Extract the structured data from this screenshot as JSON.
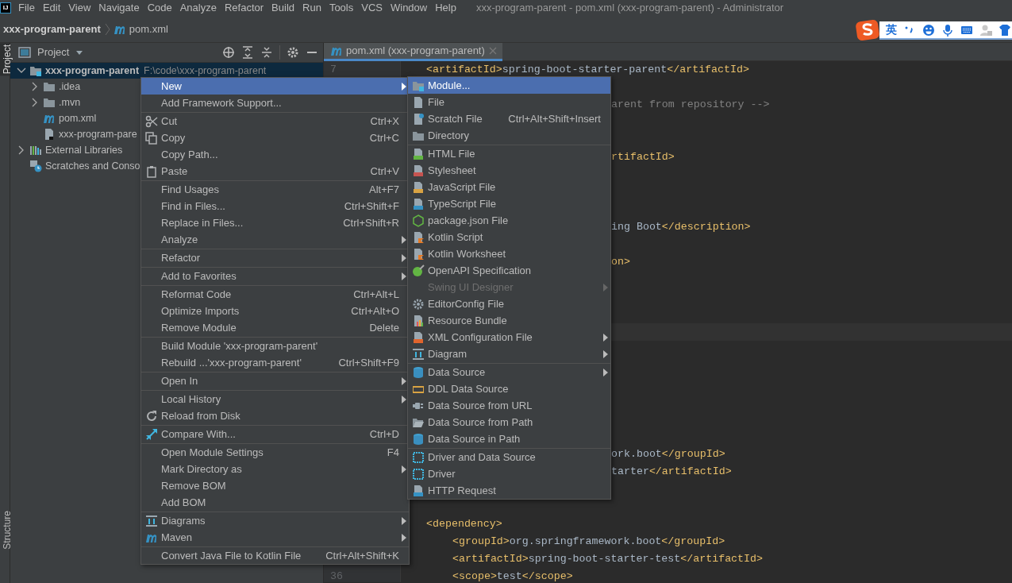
{
  "app_logo": "IJ",
  "menu_bar": [
    "File",
    "Edit",
    "View",
    "Navigate",
    "Code",
    "Analyze",
    "Refactor",
    "Build",
    "Run",
    "Tools",
    "VCS",
    "Window",
    "Help"
  ],
  "window": {
    "title": "xxx-program-parent - pom.xml (xxx-program-parent) - Administrator"
  },
  "breadcrumb": [
    "xxx-program-parent",
    "pom.xml"
  ],
  "ime_toolbar": {
    "language": "英"
  },
  "tool_stripe": [
    {
      "label": "Project",
      "selected": true
    },
    {
      "label": "Structure",
      "selected": false
    }
  ],
  "project_panel": {
    "title": "Project",
    "tree": [
      {
        "label": "xxx-program-parent",
        "path": "F:\\code\\xxx-program-parent",
        "expanded": true,
        "selected": true,
        "children": [
          {
            "label": ".idea",
            "expanded": false,
            "selected": false
          },
          {
            "label": ".mvn",
            "expanded": false,
            "selected": false
          },
          {
            "label": "pom.xml",
            "selected": false
          },
          {
            "label": "xxx-program-pare",
            "selected": false
          }
        ]
      },
      {
        "label": "External Libraries",
        "expanded": false,
        "selected": false
      },
      {
        "label": "Scratches and Conso",
        "selected": false
      }
    ]
  },
  "editor": {
    "tab": "pom.xml (xxx-program-parent)",
    "lines": [
      {
        "number": "7",
        "kind": "outer",
        "segments": [
          {
            "kind": "tag",
            "text": "<artifactId>"
          },
          {
            "kind": "text",
            "text": "spring-boot-starter-parent"
          },
          {
            "kind": "tag",
            "text": "</artifactId>"
          }
        ]
      },
      {
        "kind": "blank"
      },
      {
        "kind": "clipped",
        "segments": [
          {
            "kind": "comment",
            "text": "arent from repository -->"
          }
        ]
      },
      {
        "kind": "blank"
      },
      {
        "kind": "blank"
      },
      {
        "kind": "clipped",
        "segments": [
          {
            "kind": "tag",
            "text": "rtifactId>"
          }
        ]
      },
      {
        "kind": "blank"
      },
      {
        "kind": "blank"
      },
      {
        "kind": "blank"
      },
      {
        "kind": "clipped",
        "segments": [
          {
            "kind": "text",
            "text": "ing Boot"
          },
          {
            "kind": "tag",
            "text": "</description>"
          }
        ]
      },
      {
        "kind": "blank"
      },
      {
        "kind": "clipped",
        "segments": [
          {
            "kind": "tag",
            "text": "on>"
          }
        ]
      },
      {
        "kind": "blank"
      },
      {
        "kind": "blank"
      },
      {
        "kind": "blank"
      },
      {
        "kind": "caret"
      },
      {
        "kind": "blank"
      },
      {
        "kind": "blank"
      },
      {
        "kind": "blank"
      },
      {
        "kind": "blank"
      },
      {
        "kind": "blank"
      },
      {
        "kind": "blank"
      },
      {
        "kind": "clipped",
        "segments": [
          {
            "kind": "text",
            "text": "ork.boot"
          },
          {
            "kind": "tag",
            "text": "</groupId>"
          }
        ]
      },
      {
        "kind": "clipped",
        "segments": [
          {
            "kind": "text",
            "text": "tarter"
          },
          {
            "kind": "tag",
            "text": "</artifactId>"
          }
        ]
      },
      {
        "kind": "blank"
      },
      {
        "kind": "blank"
      },
      {
        "kind": "outer",
        "segments": [
          {
            "kind": "tag",
            "text": "<dependency>"
          }
        ]
      },
      {
        "kind": "inner",
        "segments": [
          {
            "kind": "tag",
            "text": "<groupId>"
          },
          {
            "kind": "text",
            "text": "org.springframework.boot"
          },
          {
            "kind": "tag",
            "text": "</groupId>"
          }
        ]
      },
      {
        "kind": "inner",
        "segments": [
          {
            "kind": "tag",
            "text": "<artifactId>"
          },
          {
            "kind": "text",
            "text": "spring-boot-starter-test"
          },
          {
            "kind": "tag",
            "text": "</artifactId>"
          }
        ]
      },
      {
        "number": "36",
        "kind": "inner",
        "segments": [
          {
            "kind": "tag",
            "text": "<scope>"
          },
          {
            "kind": "text",
            "text": "test"
          },
          {
            "kind": "tag",
            "text": "</scope>"
          }
        ]
      }
    ]
  },
  "context_menu": [
    {
      "kind": "item",
      "label": "New",
      "submenu": true,
      "selected": true
    },
    {
      "kind": "item",
      "label": "Add Framework Support...",
      "submenu": false,
      "selected": false
    },
    {
      "kind": "separator"
    },
    {
      "kind": "item",
      "label": "Cut",
      "shortcut": "Ctrl+X",
      "submenu": false,
      "selected": false
    },
    {
      "kind": "item",
      "label": "Copy",
      "shortcut": "Ctrl+C",
      "submenu": false,
      "selected": false
    },
    {
      "kind": "item",
      "label": "Copy Path...",
      "submenu": false,
      "selected": false
    },
    {
      "kind": "item",
      "label": "Paste",
      "shortcut": "Ctrl+V",
      "submenu": false,
      "selected": false
    },
    {
      "kind": "separator"
    },
    {
      "kind": "item",
      "label": "Find Usages",
      "shortcut": "Alt+F7",
      "submenu": false,
      "selected": false
    },
    {
      "kind": "item",
      "label": "Find in Files...",
      "shortcut": "Ctrl+Shift+F",
      "submenu": false,
      "selected": false
    },
    {
      "kind": "item",
      "label": "Replace in Files...",
      "shortcut": "Ctrl+Shift+R",
      "submenu": false,
      "selected": false
    },
    {
      "kind": "item",
      "label": "Analyze",
      "submenu": true,
      "selected": false
    },
    {
      "kind": "separator"
    },
    {
      "kind": "item",
      "label": "Refactor",
      "submenu": true,
      "selected": false
    },
    {
      "kind": "separator"
    },
    {
      "kind": "item",
      "label": "Add to Favorites",
      "submenu": true,
      "selected": false
    },
    {
      "kind": "separator"
    },
    {
      "kind": "item",
      "label": "Reformat Code",
      "shortcut": "Ctrl+Alt+L",
      "submenu": false,
      "selected": false
    },
    {
      "kind": "item",
      "label": "Optimize Imports",
      "shortcut": "Ctrl+Alt+O",
      "submenu": false,
      "selected": false
    },
    {
      "kind": "item",
      "label": "Remove Module",
      "shortcut": "Delete",
      "submenu": false,
      "selected": false
    },
    {
      "kind": "separator"
    },
    {
      "kind": "item",
      "label": "Build Module 'xxx-program-parent'",
      "submenu": false,
      "selected": false
    },
    {
      "kind": "item",
      "label": "Rebuild ...'xxx-program-parent'",
      "shortcut": "Ctrl+Shift+F9",
      "submenu": false,
      "selected": false
    },
    {
      "kind": "separator"
    },
    {
      "kind": "item",
      "label": "Open In",
      "submenu": true,
      "selected": false
    },
    {
      "kind": "separator"
    },
    {
      "kind": "item",
      "label": "Local History",
      "submenu": true,
      "selected": false
    },
    {
      "kind": "item",
      "label": "Reload from Disk",
      "submenu": false,
      "selected": false
    },
    {
      "kind": "separator"
    },
    {
      "kind": "item",
      "label": "Compare With...",
      "shortcut": "Ctrl+D",
      "submenu": false,
      "selected": false
    },
    {
      "kind": "separator"
    },
    {
      "kind": "item",
      "label": "Open Module Settings",
      "shortcut": "F4",
      "submenu": false,
      "selected": false
    },
    {
      "kind": "item",
      "label": "Mark Directory as",
      "submenu": true,
      "selected": false
    },
    {
      "kind": "item",
      "label": "Remove BOM",
      "submenu": false,
      "selected": false
    },
    {
      "kind": "item",
      "label": "Add BOM",
      "submenu": false,
      "selected": false
    },
    {
      "kind": "separator"
    },
    {
      "kind": "item",
      "label": "Diagrams",
      "submenu": true,
      "selected": false
    },
    {
      "kind": "item",
      "label": "Maven",
      "submenu": true,
      "selected": false
    },
    {
      "kind": "separator"
    },
    {
      "kind": "item",
      "label": "Convert Java File to Kotlin File",
      "shortcut": "Ctrl+Alt+Shift+K",
      "submenu": false,
      "selected": false
    }
  ],
  "new_submenu": [
    {
      "kind": "item",
      "label": "Module...",
      "submenu": false,
      "selected": true,
      "disabled": false
    },
    {
      "kind": "item",
      "label": "File",
      "submenu": false,
      "selected": false,
      "disabled": false
    },
    {
      "kind": "item",
      "label": "Scratch File",
      "shortcut": "Ctrl+Alt+Shift+Insert",
      "submenu": false,
      "selected": false,
      "disabled": false
    },
    {
      "kind": "item",
      "label": "Directory",
      "submenu": false,
      "selected": false,
      "disabled": false
    },
    {
      "kind": "separator"
    },
    {
      "kind": "item",
      "label": "HTML File",
      "submenu": false,
      "selected": false,
      "disabled": false
    },
    {
      "kind": "item",
      "label": "Stylesheet",
      "submenu": false,
      "selected": false,
      "disabled": false
    },
    {
      "kind": "item",
      "label": "JavaScript File",
      "submenu": false,
      "selected": false,
      "disabled": false
    },
    {
      "kind": "item",
      "label": "TypeScript File",
      "submenu": false,
      "selected": false,
      "disabled": false
    },
    {
      "kind": "item",
      "label": "package.json File",
      "submenu": false,
      "selected": false,
      "disabled": false
    },
    {
      "kind": "item",
      "label": "Kotlin Script",
      "submenu": false,
      "selected": false,
      "disabled": false
    },
    {
      "kind": "item",
      "label": "Kotlin Worksheet",
      "submenu": false,
      "selected": false,
      "disabled": false
    },
    {
      "kind": "item",
      "label": "OpenAPI Specification",
      "submenu": false,
      "selected": false,
      "disabled": false
    },
    {
      "kind": "item",
      "label": "Swing UI Designer",
      "submenu": true,
      "selected": false,
      "disabled": true
    },
    {
      "kind": "item",
      "label": "EditorConfig File",
      "submenu": false,
      "selected": false,
      "disabled": false
    },
    {
      "kind": "item",
      "label": "Resource Bundle",
      "submenu": false,
      "selected": false,
      "disabled": false
    },
    {
      "kind": "item",
      "label": "XML Configuration File",
      "submenu": true,
      "selected": false,
      "disabled": false
    },
    {
      "kind": "item",
      "label": "Diagram",
      "submenu": true,
      "selected": false,
      "disabled": false
    },
    {
      "kind": "separator"
    },
    {
      "kind": "item",
      "label": "Data Source",
      "submenu": true,
      "selected": false,
      "disabled": false
    },
    {
      "kind": "item",
      "label": "DDL Data Source",
      "submenu": false,
      "selected": false,
      "disabled": false
    },
    {
      "kind": "item",
      "label": "Data Source from URL",
      "submenu": false,
      "selected": false,
      "disabled": false
    },
    {
      "kind": "item",
      "label": "Data Source from Path",
      "submenu": false,
      "selected": false,
      "disabled": false
    },
    {
      "kind": "item",
      "label": "Data Source in Path",
      "submenu": false,
      "selected": false,
      "disabled": false
    },
    {
      "kind": "separator"
    },
    {
      "kind": "item",
      "label": "Driver and Data Source",
      "submenu": false,
      "selected": false,
      "disabled": false
    },
    {
      "kind": "item",
      "label": "Driver",
      "submenu": false,
      "selected": false,
      "disabled": false
    },
    {
      "kind": "item",
      "label": "HTTP Request",
      "submenu": false,
      "selected": false,
      "disabled": false
    }
  ]
}
